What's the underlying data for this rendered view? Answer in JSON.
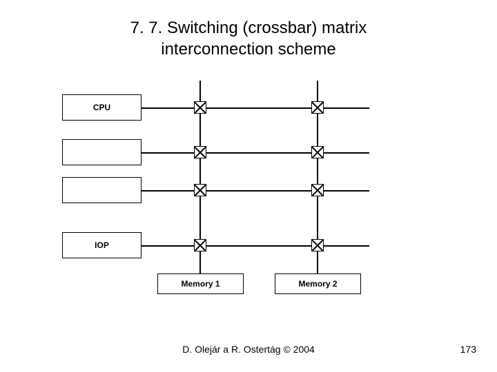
{
  "title_line1": "7. 7. Switching (crossbar) matrix",
  "title_line2": "interconnection scheme",
  "rows": {
    "r1": "CPU",
    "r2": "",
    "r3": "",
    "r4": "IOP"
  },
  "cols": {
    "c1": "Memory 1",
    "c2": "Memory 2"
  },
  "footer": "D. Olejár a R. Ostertág © 2004",
  "page": "173"
}
